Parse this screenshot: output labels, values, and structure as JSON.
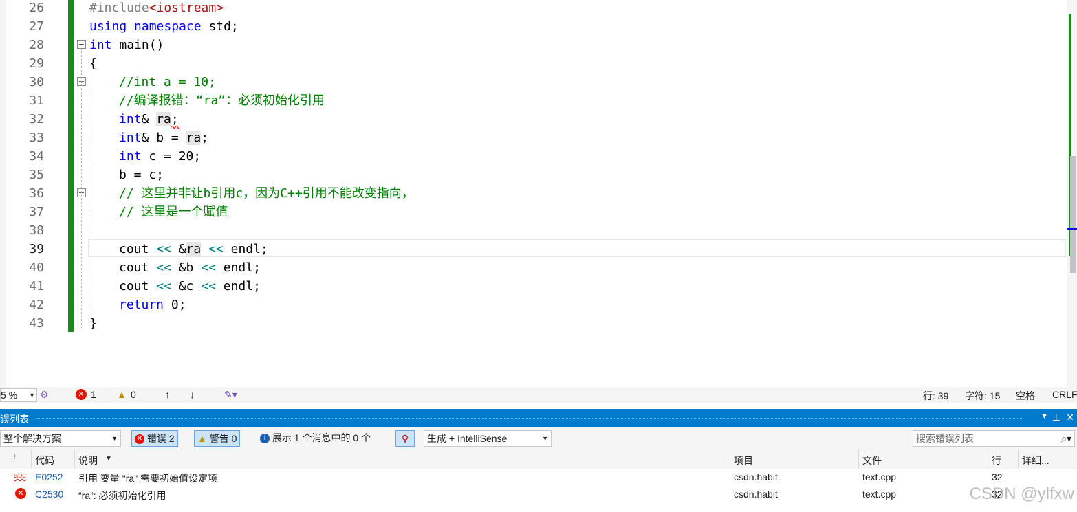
{
  "editor": {
    "line_numbers": [
      "26",
      "27",
      "28",
      "29",
      "30",
      "31",
      "32",
      "33",
      "34",
      "35",
      "36",
      "37",
      "38",
      "39",
      "40",
      "41",
      "42",
      "43"
    ],
    "lines": {
      "l26_pp": "#include",
      "l26_inc": "<iostream>",
      "l27_kw1": "using",
      "l27_kw2": "namespace",
      "l27_rest": " std;",
      "l28_kw": "int",
      "l28_rest": " main()",
      "l29": "{",
      "l30": "//int a = 10;",
      "l31": "//编译报错：“ra”：必须初始化引用",
      "l32_kw": "int",
      "l32_a": "& ",
      "l32_var": "ra",
      "l32_end": ";",
      "l33_kw": "int",
      "l33_a": "& b = ",
      "l33_var": "ra",
      "l33_end": ";",
      "l34_kw": "int",
      "l34_rest": " c = 20;",
      "l35": "b = c;",
      "l36": "// 这里并非让b引用c，因为C++引用不能改变指向，",
      "l37": "// 这里是一个赋值",
      "l39_a": "cout ",
      "l39_op1": "<<",
      "l39_b": " &",
      "l39_var": "ra",
      "l39_c": " ",
      "l39_op2": "<<",
      "l39_d": " endl;",
      "l40_a": "cout ",
      "l40_op1": "<<",
      "l40_b": " &b ",
      "l40_op2": "<<",
      "l40_d": " endl;",
      "l41_a": "cout ",
      "l41_op1": "<<",
      "l41_b": " &c ",
      "l41_op2": "<<",
      "l41_d": " endl;",
      "l42_kw": "return",
      "l42_rest": " 0;",
      "l43": "}"
    },
    "current_line": "39"
  },
  "status_bar": {
    "zoom": "5 %",
    "error_count": "1",
    "warning_count": "0",
    "row": "行: 39",
    "col": "字符: 15",
    "spaces": "空格",
    "eol": "CRLF"
  },
  "error_list": {
    "title": "误列表",
    "scope": "整个解决方案",
    "errors_btn": "错误 2",
    "warnings_btn": "警告 0",
    "messages_btn": "展示 1 个消息中的 0 个",
    "source": "生成 + IntelliSense",
    "search_placeholder": "搜索错误列表",
    "columns": [
      "代码",
      "说明",
      "项目",
      "文件",
      "行",
      "详细..."
    ],
    "rows": [
      {
        "code": "E0252",
        "desc": "引用 变量 \"ra\" 需要初始值设定项",
        "project": "csdn.habit",
        "file": "text.cpp",
        "line": "32"
      },
      {
        "code": "C2530",
        "desc": "“ra”: 必须初始化引用",
        "project": "csdn.habit",
        "file": "text.cpp",
        "line": "32"
      }
    ]
  },
  "watermark": "CSDN @ylfxw",
  "colors": {
    "accent": "#007acc",
    "change_bar": "#1b8a1b",
    "keyword": "#0000ff",
    "comment": "#008000"
  }
}
